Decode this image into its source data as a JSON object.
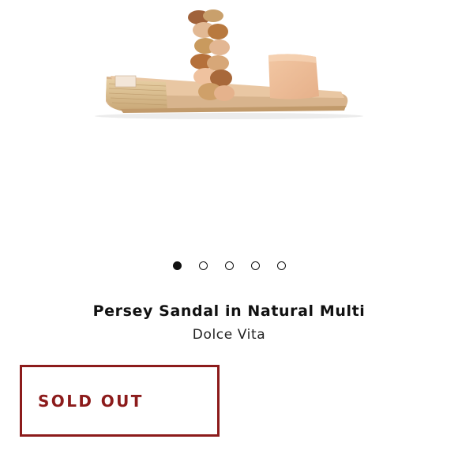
{
  "product": {
    "title": "Persey Sandal in Natural Multi",
    "brand": "Dolce Vita",
    "image_icon": "sandal-image"
  },
  "carousel": {
    "total": 5,
    "active_index": 0
  },
  "status": {
    "label": "SOLD OUT"
  },
  "colors": {
    "accent": "#8c1b1b",
    "dot": "#111111"
  }
}
